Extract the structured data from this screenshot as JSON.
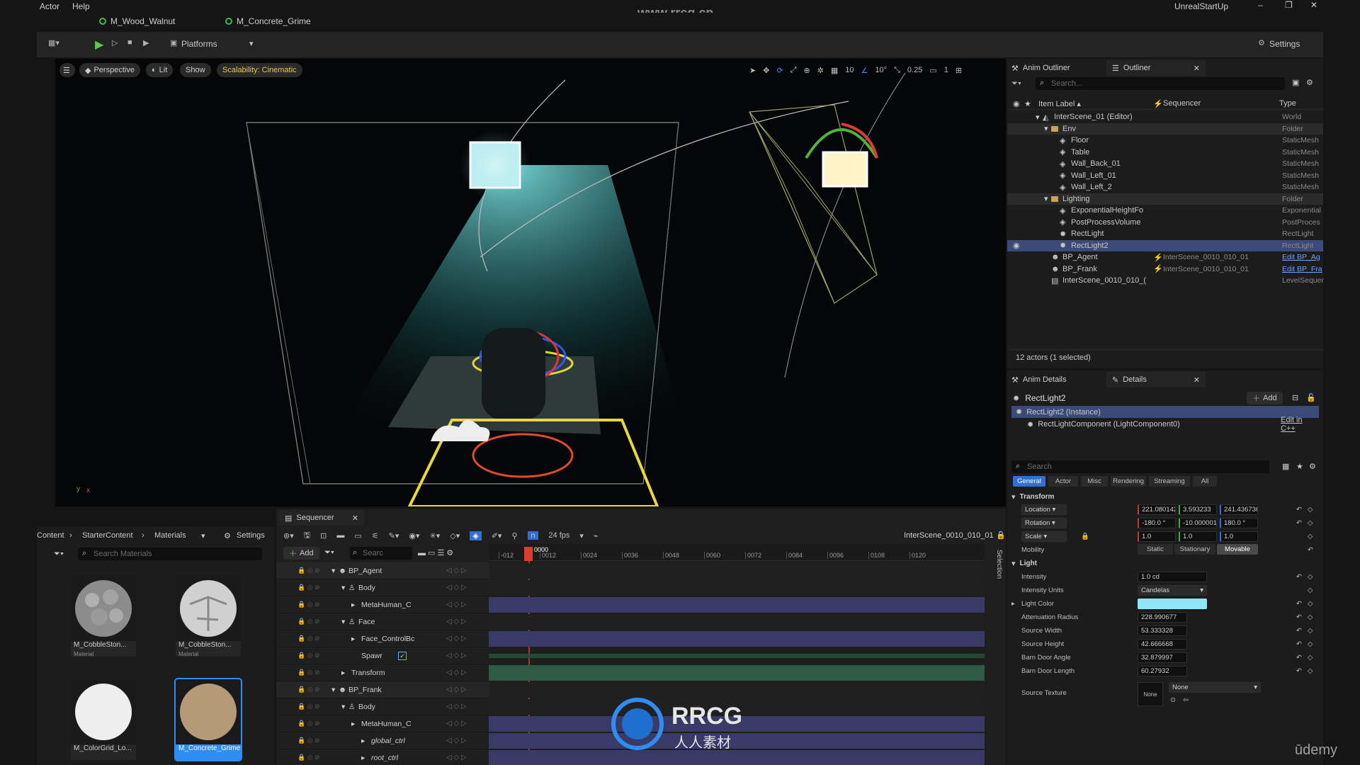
{
  "menu": {
    "items": [
      "Actor",
      "Help"
    ],
    "app_name": "UnrealStartUp",
    "watermark": "www.rrcg.cn"
  },
  "doc_tabs": [
    "M_Wood_Walnut",
    "M_Concrete_Grime"
  ],
  "toolbar": {
    "platforms": "Platforms",
    "settings": "Settings"
  },
  "viewport": {
    "perspective": "Perspective",
    "lit": "Lit",
    "show": "Show",
    "scalability": "Scalability: Cinematic",
    "grid_snap": "10",
    "rot_snap": "10°",
    "scale_snap": "0.25",
    "camera_speed": "1"
  },
  "outliner": {
    "tab_anim": "Anim Outliner",
    "tab_outliner": "Outliner",
    "search_placeholder": "Search...",
    "col_label": "Item Label ▴",
    "col_sequencer": "Sequencer",
    "col_type": "Type",
    "rows": [
      {
        "label": "InterScene_01 (Editor)",
        "type": "World",
        "indent": 0,
        "kind": "world"
      },
      {
        "label": "Env",
        "type": "Folder",
        "indent": 1,
        "kind": "folder"
      },
      {
        "label": "Floor",
        "type": "StaticMesh",
        "indent": 2,
        "kind": "mesh"
      },
      {
        "label": "Table",
        "type": "StaticMesh",
        "indent": 2,
        "kind": "mesh"
      },
      {
        "label": "Wall_Back_01",
        "type": "StaticMesh",
        "indent": 2,
        "kind": "mesh"
      },
      {
        "label": "Wall_Left_01",
        "type": "StaticMesh",
        "indent": 2,
        "kind": "mesh"
      },
      {
        "label": "Wall_Left_2",
        "type": "StaticMesh",
        "indent": 2,
        "kind": "mesh"
      },
      {
        "label": "Lighting",
        "type": "Folder",
        "indent": 1,
        "kind": "folder"
      },
      {
        "label": "ExponentialHeightFo",
        "type": "Exponential",
        "indent": 2,
        "kind": "mesh"
      },
      {
        "label": "PostProcessVolume",
        "type": "PostProces",
        "indent": 2,
        "kind": "mesh"
      },
      {
        "label": "RectLight",
        "type": "RectLight",
        "indent": 2,
        "kind": "light"
      },
      {
        "label": "RectLight2",
        "type": "RectLight",
        "indent": 2,
        "kind": "light",
        "selected": true
      },
      {
        "label": "BP_Agent",
        "type": "Edit BP_Ag",
        "indent": 1,
        "kind": "bp",
        "seq": "InterScene_0010_010_01"
      },
      {
        "label": "BP_Frank",
        "type": "Edit BP_Fra",
        "indent": 1,
        "kind": "bp",
        "seq": "InterScene_0010_010_01"
      },
      {
        "label": "InterScene_0010_010_(",
        "type": "LevelSequer",
        "indent": 1,
        "kind": "seqactor"
      }
    ],
    "status": "12 actors (1 selected)"
  },
  "details": {
    "tab_anim": "Anim Details",
    "tab_details": "Details",
    "object_name": "RectLight2",
    "add_label": "Add",
    "instance": "RectLight2 (Instance)",
    "component": "RectLightComponent (LightComponent0)",
    "edit_cpp": "Edit in C++",
    "search_placeholder": "Search",
    "filter_tabs": [
      "General",
      "Actor",
      "Misc",
      "Rendering",
      "Streaming",
      "All"
    ],
    "transform_header": "Transform",
    "location_label": "Location",
    "location": [
      "221.080142",
      "3.593233",
      "241.436736"
    ],
    "rotation_label": "Rotation",
    "rotation": [
      "-180.0 °",
      "-10.000001 °",
      "180.0 °"
    ],
    "scale_label": "Scale",
    "scale": [
      "1.0",
      "1.0",
      "1.0"
    ],
    "mobility_label": "Mobility",
    "mobility": [
      "Static",
      "Stationary",
      "Movable"
    ],
    "light_header": "Light",
    "intensity_label": "Intensity",
    "intensity": "1.0 cd",
    "intensity_units_label": "Intensity Units",
    "intensity_units": "Candelas",
    "light_color_label": "Light Color",
    "light_color": "#8fe6f5",
    "attenuation_label": "Attenuation Radius",
    "attenuation": "228.990677",
    "source_width_label": "Source Width",
    "source_width": "53.333328",
    "source_height_label": "Source Height",
    "source_height": "42.666668",
    "barn_angle_label": "Barn Door Angle",
    "barn_angle": "32.879997",
    "barn_length_label": "Barn Door Length",
    "barn_length": "60.27932",
    "source_texture_label": "Source Texture",
    "source_texture_none": "None",
    "source_texture_dropdown": "None"
  },
  "content_browser": {
    "breadcrumb": [
      "Content",
      "StarterContent",
      "Materials"
    ],
    "settings": "Settings",
    "search_placeholder": "Search Materials",
    "assets": [
      {
        "name": "M_CobbleSton...",
        "kind": "Material"
      },
      {
        "name": "M_CobbleSton...",
        "kind": "Material"
      },
      {
        "name": "M_ColorGrid_Lo...",
        "kind": ""
      },
      {
        "name": "M_Concrete_Grime",
        "kind": ""
      }
    ]
  },
  "sequencer": {
    "tab": "Sequencer",
    "fps": "24 fps",
    "sequence_name": "InterScene_0010_010_01",
    "add_label": "Add",
    "search_placeholder": "Searc",
    "current_frame": "0000",
    "ticks": [
      "-012",
      "0012",
      "0024",
      "0036",
      "0048",
      "0060",
      "0072",
      "0084",
      "0096",
      "0108",
      "0120"
    ],
    "side_label": "Selection",
    "tracks": [
      {
        "label": "BP_Agent",
        "indent": 0,
        "kind": "actor"
      },
      {
        "label": "Body",
        "indent": 1,
        "kind": "comp"
      },
      {
        "label": "MetaHuman_C",
        "indent": 2,
        "kind": "anim"
      },
      {
        "label": "Face",
        "indent": 1,
        "kind": "comp"
      },
      {
        "label": "Face_ControlBc",
        "indent": 2,
        "kind": "anim"
      },
      {
        "label": "Spawr",
        "indent": 2,
        "kind": "spawn"
      },
      {
        "label": "Transform",
        "indent": 1,
        "kind": "transform"
      },
      {
        "label": "BP_Frank",
        "indent": 0,
        "kind": "actor"
      },
      {
        "label": "Body",
        "indent": 1,
        "kind": "comp"
      },
      {
        "label": "MetaHuman_C",
        "indent": 2,
        "kind": "anim"
      },
      {
        "label": "global_ctrl",
        "indent": 3,
        "kind": "ctrl"
      },
      {
        "label": "root_ctrl",
        "indent": 3,
        "kind": "ctrl"
      }
    ]
  },
  "overlay": {
    "logo_text": "RRCG",
    "logo_sub": "人人素材",
    "udemy": "ūdemy"
  }
}
